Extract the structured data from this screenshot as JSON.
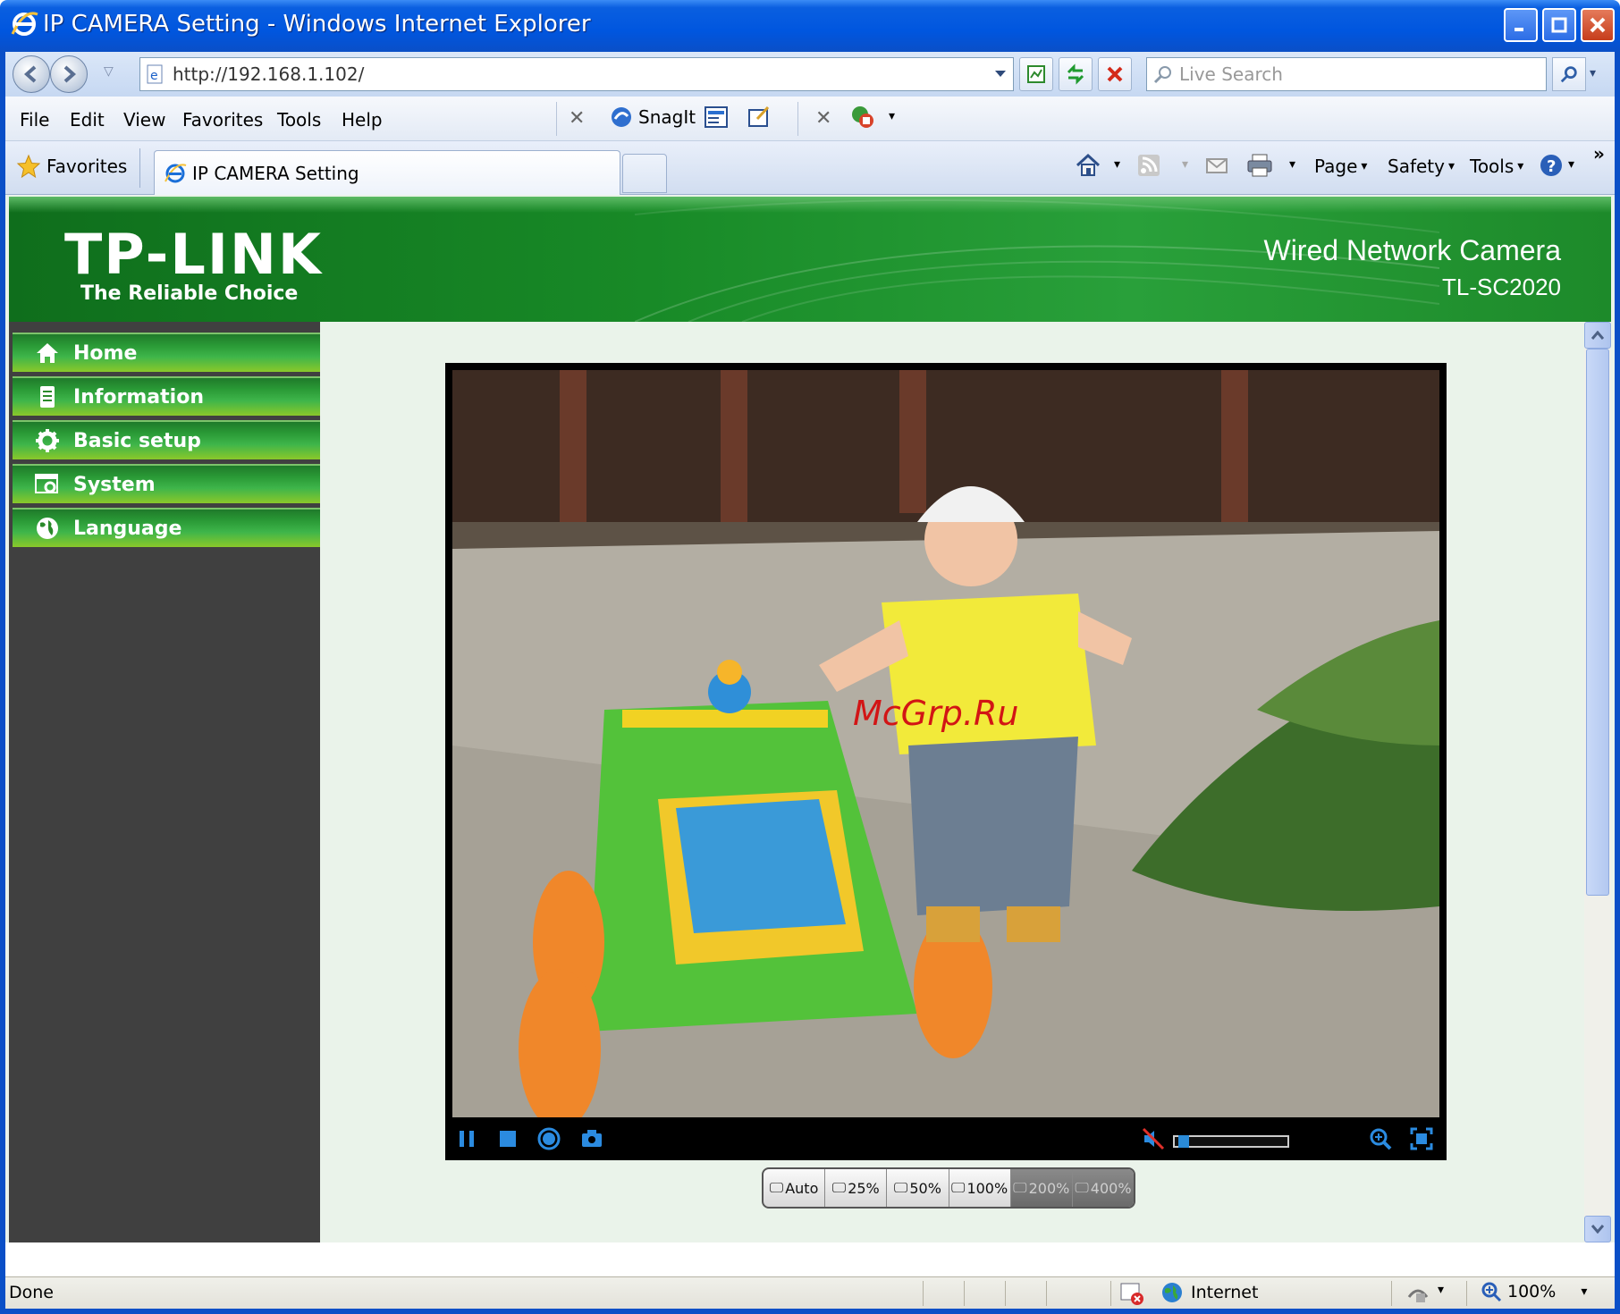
{
  "window": {
    "title": "IP CAMERA Setting - Windows Internet Explorer"
  },
  "address_bar": {
    "url": "http://192.168.1.102/",
    "search_placeholder": "Live Search"
  },
  "menu": {
    "items": [
      "File",
      "Edit",
      "View",
      "Favorites",
      "Tools",
      "Help"
    ],
    "snagit_label": "SnagIt"
  },
  "tabs": {
    "favorites_label": "Favorites",
    "active_tab": "IP CAMERA Setting"
  },
  "command_bar": {
    "page_label": "Page",
    "safety_label": "Safety",
    "tools_label": "Tools"
  },
  "banner": {
    "logo": "TP-LINK",
    "tagline": "The Reliable Choice",
    "product_name": "Wired Network Camera",
    "model": "TL-SC2020"
  },
  "sidebar": {
    "items": [
      {
        "label": "Home",
        "icon": "home-icon"
      },
      {
        "label": "Information",
        "icon": "document-icon"
      },
      {
        "label": "Basic setup",
        "icon": "gear-icon"
      },
      {
        "label": "System",
        "icon": "system-icon"
      },
      {
        "label": "Language",
        "icon": "globe-icon"
      }
    ]
  },
  "video": {
    "watermark": "McGrp.Ru",
    "volume_level": 0.05
  },
  "zoom": {
    "buttons": [
      "Auto",
      "25%",
      "50%",
      "100%",
      "200%",
      "400%"
    ]
  },
  "status": {
    "text": "Done",
    "zone": "Internet",
    "zoom_level": "100%"
  },
  "colors": {
    "brand_green": "#188a27",
    "sidebar_bg": "#404040",
    "xp_blue": "#0056df"
  }
}
